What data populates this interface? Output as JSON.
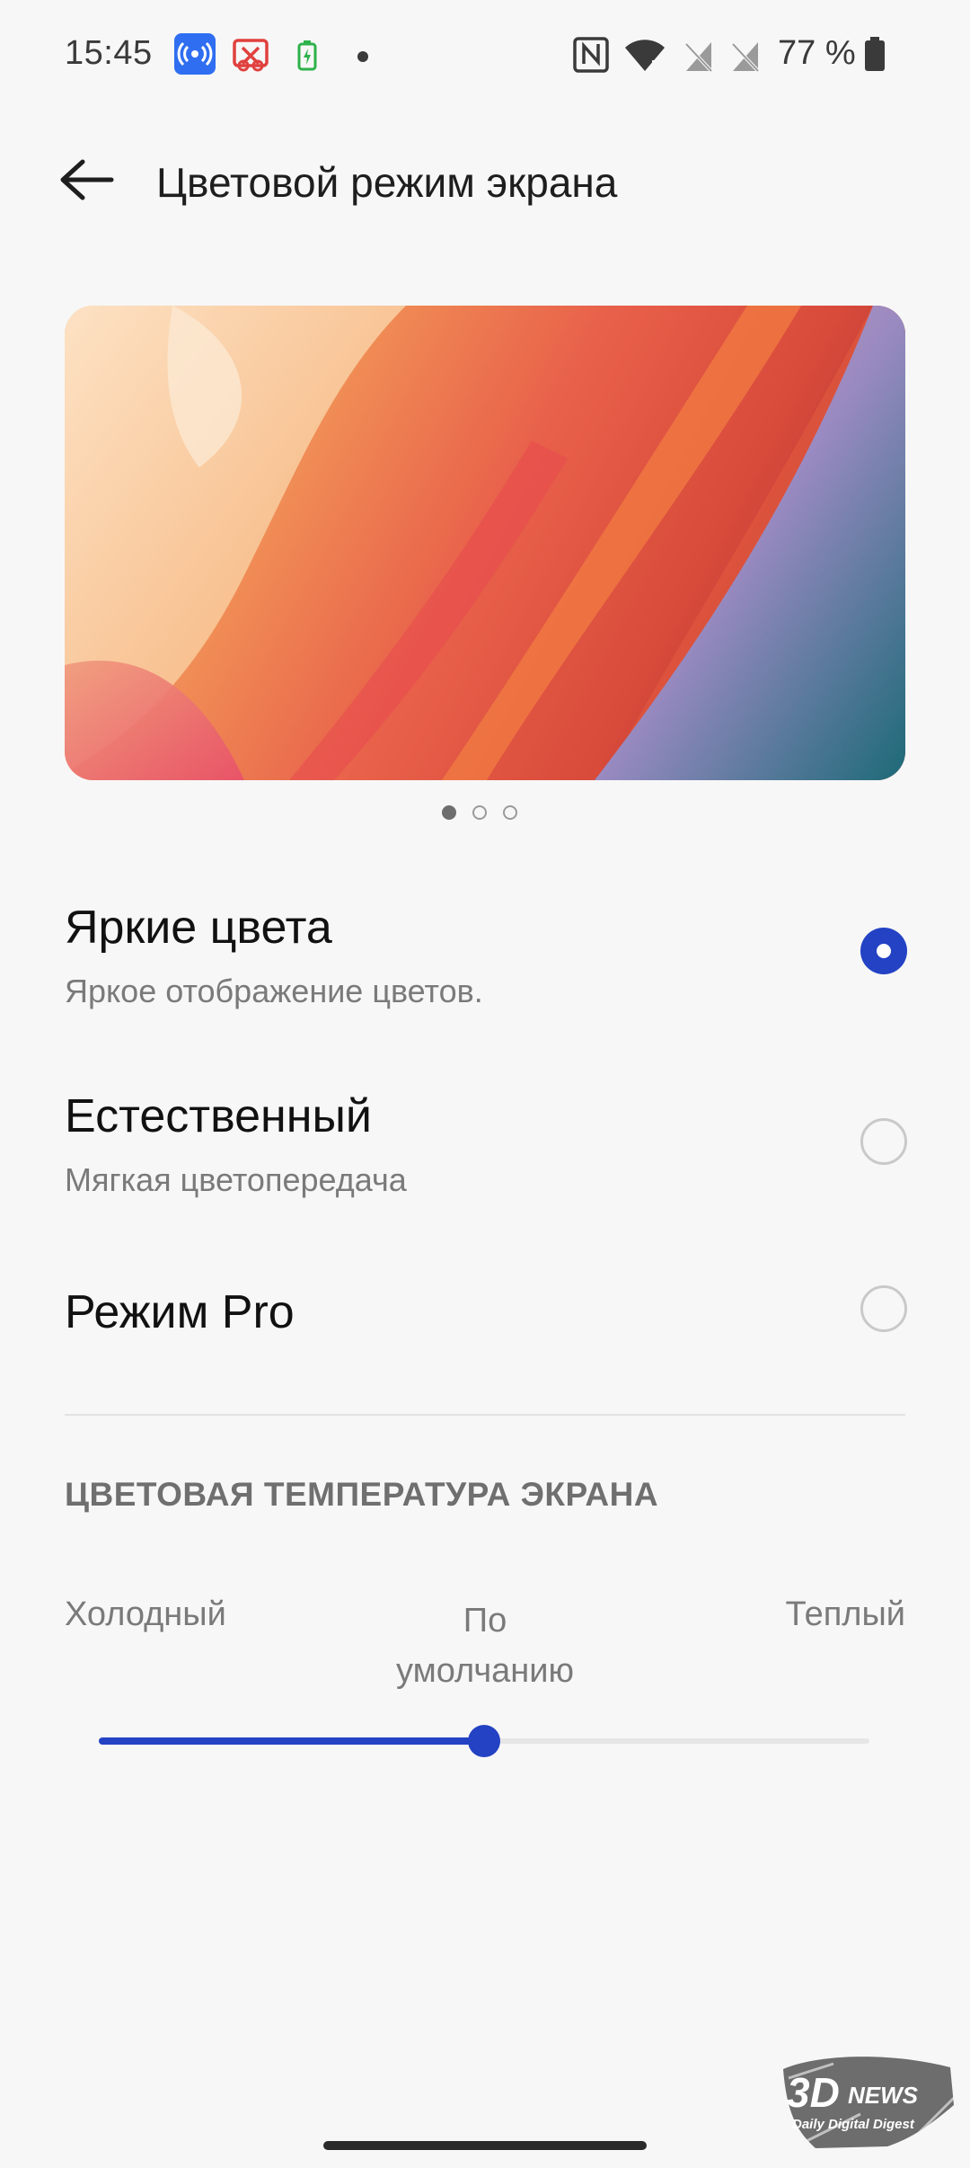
{
  "status_bar": {
    "time": "15:45",
    "battery": "77 %",
    "icons": [
      "hotspot-icon",
      "screen-record-icon",
      "battery-saver-icon",
      "dot-icon",
      "nfc-icon",
      "wifi-icon",
      "no-sim-icon",
      "no-sim-icon",
      "battery-icon"
    ]
  },
  "header": {
    "title": "Цветовой режим экрана"
  },
  "preview": {
    "page_count": 3,
    "active_page": 1
  },
  "options": [
    {
      "title": "Яркие цвета",
      "subtitle": "Яркое отображение цветов.",
      "selected": true
    },
    {
      "title": "Естественный",
      "subtitle": "Мягкая цветопередача",
      "selected": false
    },
    {
      "title": "Режим Pro",
      "subtitle": "",
      "selected": false
    }
  ],
  "temperature": {
    "section_title": "ЦВЕТОВАЯ ТЕМПЕРАТУРА ЭКРАНА",
    "label_left": "Холодный",
    "label_center_line1": "По",
    "label_center_line2": "умолчанию",
    "label_right": "Теплый",
    "value_fraction": 0.5
  },
  "watermark": {
    "logo_text": "3DNEWS",
    "tagline": "Daily Digital Digest"
  },
  "colors": {
    "accent": "#2342c4",
    "background": "#f7f7f7"
  }
}
